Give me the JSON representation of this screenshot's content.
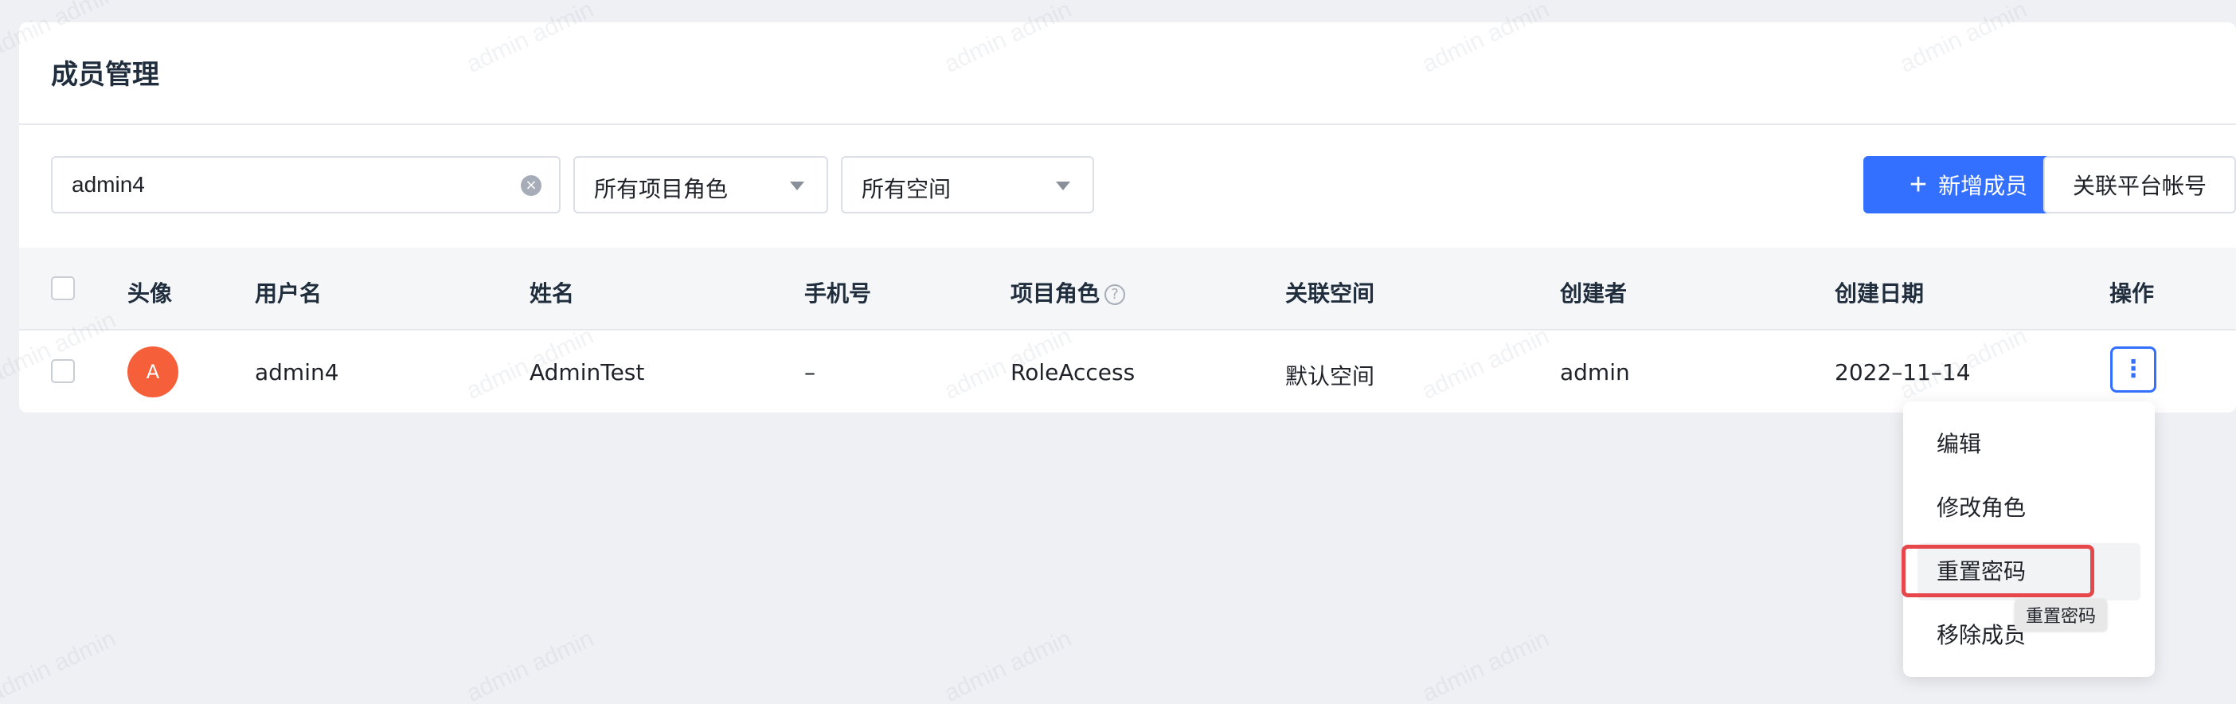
{
  "page": {
    "title": "成员管理"
  },
  "filters": {
    "search_value": "admin4",
    "role_select": "所有项目角色",
    "space_select": "所有空间"
  },
  "actions": {
    "add_member": "新增成员",
    "link_account": "关联平台帐号"
  },
  "table": {
    "columns": {
      "avatar": "头像",
      "username": "用户名",
      "name": "姓名",
      "phone": "手机号",
      "role": "项目角色",
      "space": "关联空间",
      "creator": "创建者",
      "date": "创建日期",
      "ops": "操作"
    },
    "rows": [
      {
        "avatar_letter": "A",
        "username": "admin4",
        "name": "AdminTest",
        "phone": "–",
        "role": "RoleAccess",
        "space": "默认空间",
        "creator": "admin",
        "date": "2022–11–14"
      }
    ]
  },
  "dropdown": {
    "items": [
      "编辑",
      "修改角色",
      "重置密码",
      "移除成员"
    ],
    "tooltip": "重置密码"
  },
  "watermark": "admin admin",
  "colors": {
    "primary": "#3370ff",
    "avatar": "#f5603a",
    "highlight": "#e5474a"
  }
}
